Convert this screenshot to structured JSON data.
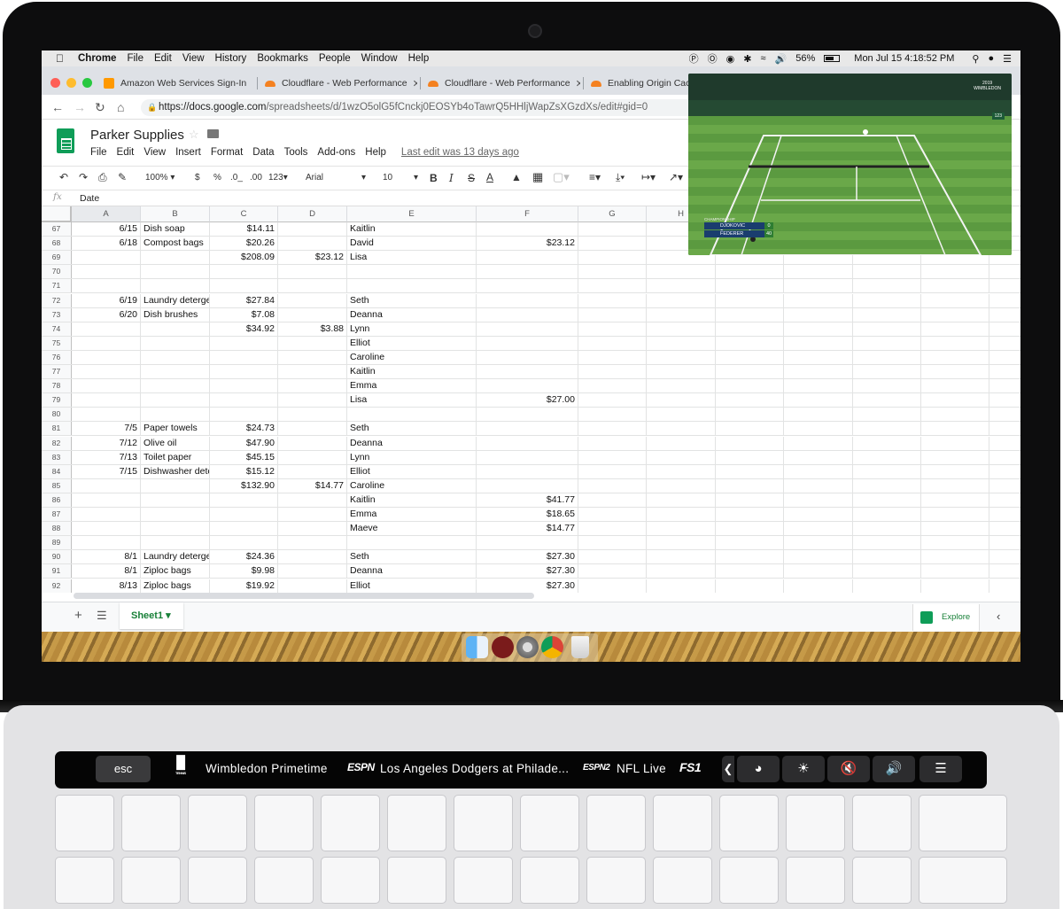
{
  "menubar": {
    "apple_icon": "apple-icon",
    "app": "Chrome",
    "items": [
      "File",
      "Edit",
      "View",
      "History",
      "Bookmarks",
      "People",
      "Window",
      "Help"
    ],
    "battery": "56%",
    "clock": "Mon Jul 15  4:18:52 PM"
  },
  "tabs": [
    {
      "label": "Amazon Web Services Sign-In",
      "color": "#ff9900"
    },
    {
      "label": "Cloudflare - Web Performance",
      "color": "#f48120"
    },
    {
      "label": "Cloudflare - Web Performance",
      "color": "#f48120"
    },
    {
      "label": "Enabling Origin Cach",
      "color": "#f48120"
    }
  ],
  "address": {
    "host": "https://docs.google.com",
    "path": "/spreadsheets/d/1wzO5olG5fCnckj0EOSYb4oTawrQ5HHljWapZsXGzdXs/edit#gid=0"
  },
  "doc": {
    "title": "Parker Supplies",
    "menus": [
      "File",
      "Edit",
      "View",
      "Insert",
      "Format",
      "Data",
      "Tools",
      "Add-ons",
      "Help"
    ],
    "last_edit": "Last edit was 13 days ago"
  },
  "toolbar": {
    "zoom": "100%",
    "currency": "$",
    "percent": "%",
    "dec_less": ".0_",
    "dec_more": ".00",
    "format": "123",
    "font": "Arial",
    "size": "10",
    "bold": "B",
    "italic": "I",
    "strike": "S",
    "color": "A"
  },
  "formula": {
    "fx": "fx",
    "value": "Date"
  },
  "columns": [
    "A",
    "B",
    "C",
    "D",
    "E",
    "F",
    "G",
    "H"
  ],
  "rows": [
    {
      "n": "67",
      "a": "6/15",
      "b": "Dish soap",
      "c": "$14.11",
      "d": "",
      "e": "Kaitlin",
      "f": ""
    },
    {
      "n": "68",
      "a": "6/18",
      "b": "Compost bags",
      "c": "$20.26",
      "d": "",
      "e": "David",
      "f": "$23.12"
    },
    {
      "n": "69",
      "a": "",
      "b": "",
      "c": "$208.09",
      "d": "$23.12",
      "e": "Lisa",
      "f": ""
    },
    {
      "n": "70",
      "a": "",
      "b": "",
      "c": "",
      "d": "",
      "e": "",
      "f": ""
    },
    {
      "n": "71",
      "a": "",
      "b": "",
      "c": "",
      "d": "",
      "e": "",
      "f": ""
    },
    {
      "n": "72",
      "a": "6/19",
      "b": "Laundry deterger",
      "c": "$27.84",
      "d": "",
      "e": "Seth",
      "f": ""
    },
    {
      "n": "73",
      "a": "6/20",
      "b": "Dish brushes",
      "c": "$7.08",
      "d": "",
      "e": "Deanna",
      "f": ""
    },
    {
      "n": "74",
      "a": "",
      "b": "",
      "c": "$34.92",
      "d": "$3.88",
      "e": "Lynn",
      "f": ""
    },
    {
      "n": "75",
      "a": "",
      "b": "",
      "c": "",
      "d": "",
      "e": "Elliot",
      "f": ""
    },
    {
      "n": "76",
      "a": "",
      "b": "",
      "c": "",
      "d": "",
      "e": "Caroline",
      "f": ""
    },
    {
      "n": "77",
      "a": "",
      "b": "",
      "c": "",
      "d": "",
      "e": "Kaitlin",
      "f": ""
    },
    {
      "n": "78",
      "a": "",
      "b": "",
      "c": "",
      "d": "",
      "e": "Emma",
      "f": ""
    },
    {
      "n": "79",
      "a": "",
      "b": "",
      "c": "",
      "d": "",
      "e": "Lisa",
      "f": "$27.00"
    },
    {
      "n": "80",
      "a": "",
      "b": "",
      "c": "",
      "d": "",
      "e": "",
      "f": ""
    },
    {
      "n": "81",
      "a": "7/5",
      "b": "Paper towels",
      "c": "$24.73",
      "d": "",
      "e": "Seth",
      "f": ""
    },
    {
      "n": "82",
      "a": "7/12",
      "b": "Olive oil",
      "c": "$47.90",
      "d": "",
      "e": "Deanna",
      "f": ""
    },
    {
      "n": "83",
      "a": "7/13",
      "b": "Toilet paper",
      "c": "$45.15",
      "d": "",
      "e": "Lynn",
      "f": ""
    },
    {
      "n": "84",
      "a": "7/15",
      "b": "Dishwasher dete",
      "c": "$15.12",
      "d": "",
      "e": "Elliot",
      "f": ""
    },
    {
      "n": "85",
      "a": "",
      "b": "",
      "c": "$132.90",
      "d": "$14.77",
      "e": "Caroline",
      "f": ""
    },
    {
      "n": "86",
      "a": "",
      "b": "",
      "c": "",
      "d": "",
      "e": "Kaitlin",
      "f": "$41.77"
    },
    {
      "n": "87",
      "a": "",
      "b": "",
      "c": "",
      "d": "",
      "e": "Emma",
      "f": "$18.65"
    },
    {
      "n": "88",
      "a": "",
      "b": "",
      "c": "",
      "d": "",
      "e": "Maeve",
      "f": "$14.77"
    },
    {
      "n": "89",
      "a": "",
      "b": "",
      "c": "",
      "d": "",
      "e": "",
      "f": ""
    },
    {
      "n": "90",
      "a": "8/1",
      "b": "Laundry deterger",
      "c": "$24.36",
      "d": "",
      "e": "Seth",
      "f": "$27.30"
    },
    {
      "n": "91",
      "a": "8/1",
      "b": "Ziploc bags",
      "c": "$9.98",
      "d": "",
      "e": "Deanna",
      "f": "$27.30"
    },
    {
      "n": "92",
      "a": "8/13",
      "b": "Ziploc bags",
      "c": "$19.92",
      "d": "",
      "e": "Elliot",
      "f": "$27.30"
    }
  ],
  "sheetbar": {
    "add": "+",
    "sheet": "Sheet1",
    "explore": "Explore"
  },
  "pip": {
    "brand_year": "2019",
    "brand": "WIMBLEDON",
    "counter": "123",
    "score_label": "CHAMPIONSHIP",
    "players": [
      {
        "name": "DJOKOVIC",
        "score": "0"
      },
      {
        "name": "FEDERER",
        "score": "40"
      }
    ]
  },
  "touchbar": {
    "esc": "esc",
    "items": [
      {
        "logo": "TENNIS",
        "label": "Wimbledon Primetime"
      },
      {
        "logo": "ESPN",
        "label": "Los Angeles Dodgers at Philade..."
      },
      {
        "logo": "ESPN2",
        "label": "NFL Live"
      },
      {
        "logo": "FS1",
        "label": ""
      }
    ],
    "controls": [
      "chevron-left-icon",
      "brightness-slider-icon",
      "brightness-icon",
      "mute-icon",
      "volume-icon",
      "siri-list-icon"
    ]
  }
}
